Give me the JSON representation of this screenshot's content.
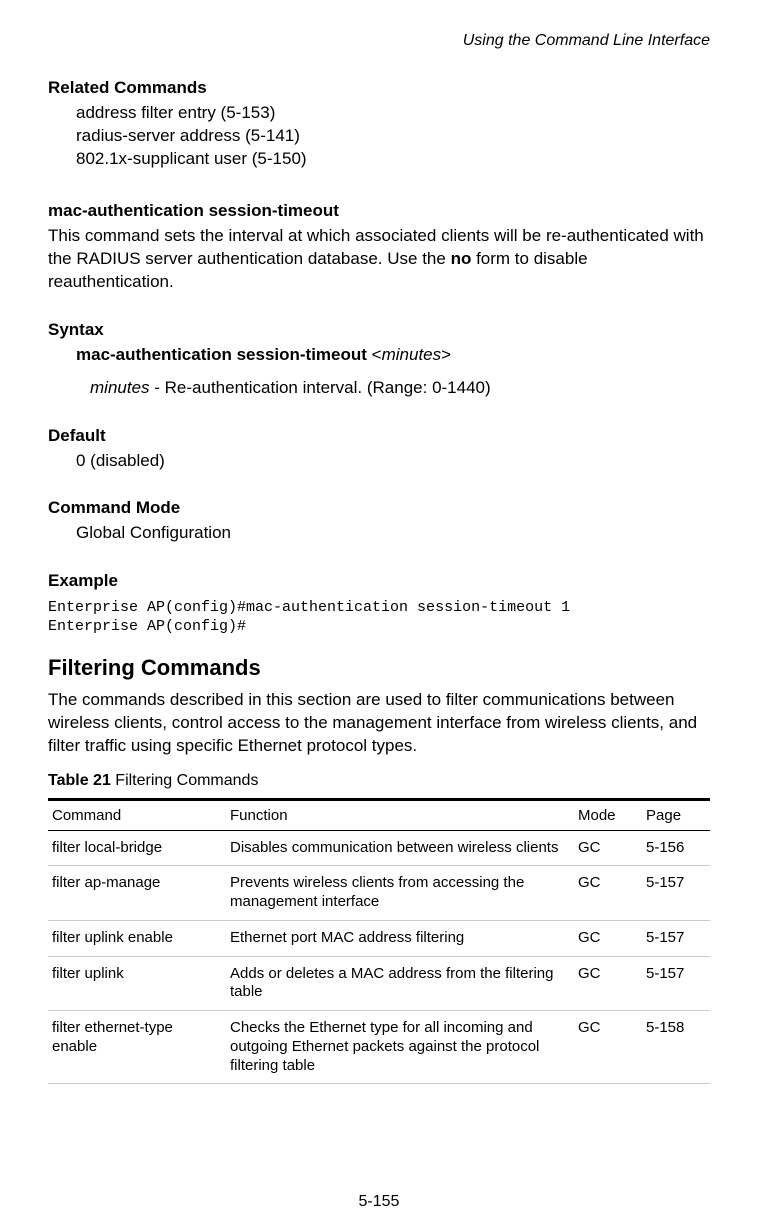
{
  "header": {
    "title": "Using the Command Line Interface"
  },
  "related_commands": {
    "heading": "Related Commands",
    "items": [
      "address filter entry (5-153)",
      "radius-server address (5-141)",
      "802.1x-supplicant user (5-150)"
    ]
  },
  "mac_auth": {
    "heading": "mac-authentication session-timeout",
    "desc_pre": "This command sets the interval at which associated clients will be re-authenticated with the RADIUS server authentication database. Use the ",
    "desc_bold": "no",
    "desc_post": " form to disable reauthentication.",
    "syntax_heading": "Syntax",
    "syntax_cmd": "mac-authentication session-timeout",
    "syntax_arg_open": " <",
    "syntax_arg": "minutes",
    "syntax_arg_close": ">",
    "minutes_label": "minutes",
    "minutes_desc": " - Re-authentication interval. (Range: 0-1440)",
    "default_heading": "Default",
    "default_value": "0 (disabled)",
    "mode_heading": "Command Mode",
    "mode_value": "Global Configuration",
    "example_heading": "Example",
    "example_code": "Enterprise AP(config)#mac-authentication session-timeout 1\nEnterprise AP(config)#"
  },
  "filtering": {
    "heading": "Filtering Commands",
    "desc": "The commands described in this section are used to filter communications between wireless clients, control access to the management interface from wireless clients, and filter traffic using specific Ethernet protocol types.",
    "table_label_bold": "Table 21",
    "table_label_rest": "   Filtering Commands",
    "columns": {
      "command": "Command",
      "function": "Function",
      "mode": "Mode",
      "page": "Page"
    },
    "rows": [
      {
        "command": "filter local-bridge",
        "function": "Disables communication between wireless clients",
        "mode": "GC",
        "page": "5-156"
      },
      {
        "command": "filter ap-manage",
        "function": "Prevents wireless clients from accessing the management interface",
        "mode": "GC",
        "page": "5-157"
      },
      {
        "command": "filter uplink enable",
        "function": "Ethernet port MAC address filtering",
        "mode": "GC",
        "page": "5-157"
      },
      {
        "command": "filter uplink",
        "function": "Adds or deletes a MAC address from the filtering table",
        "mode": "GC",
        "page": "5-157"
      },
      {
        "command": "filter ethernet-type enable",
        "function": "Checks the Ethernet type for all incoming and outgoing Ethernet packets against the protocol filtering table",
        "mode": "GC",
        "page": "5-158"
      }
    ]
  },
  "page_number": "5-155"
}
